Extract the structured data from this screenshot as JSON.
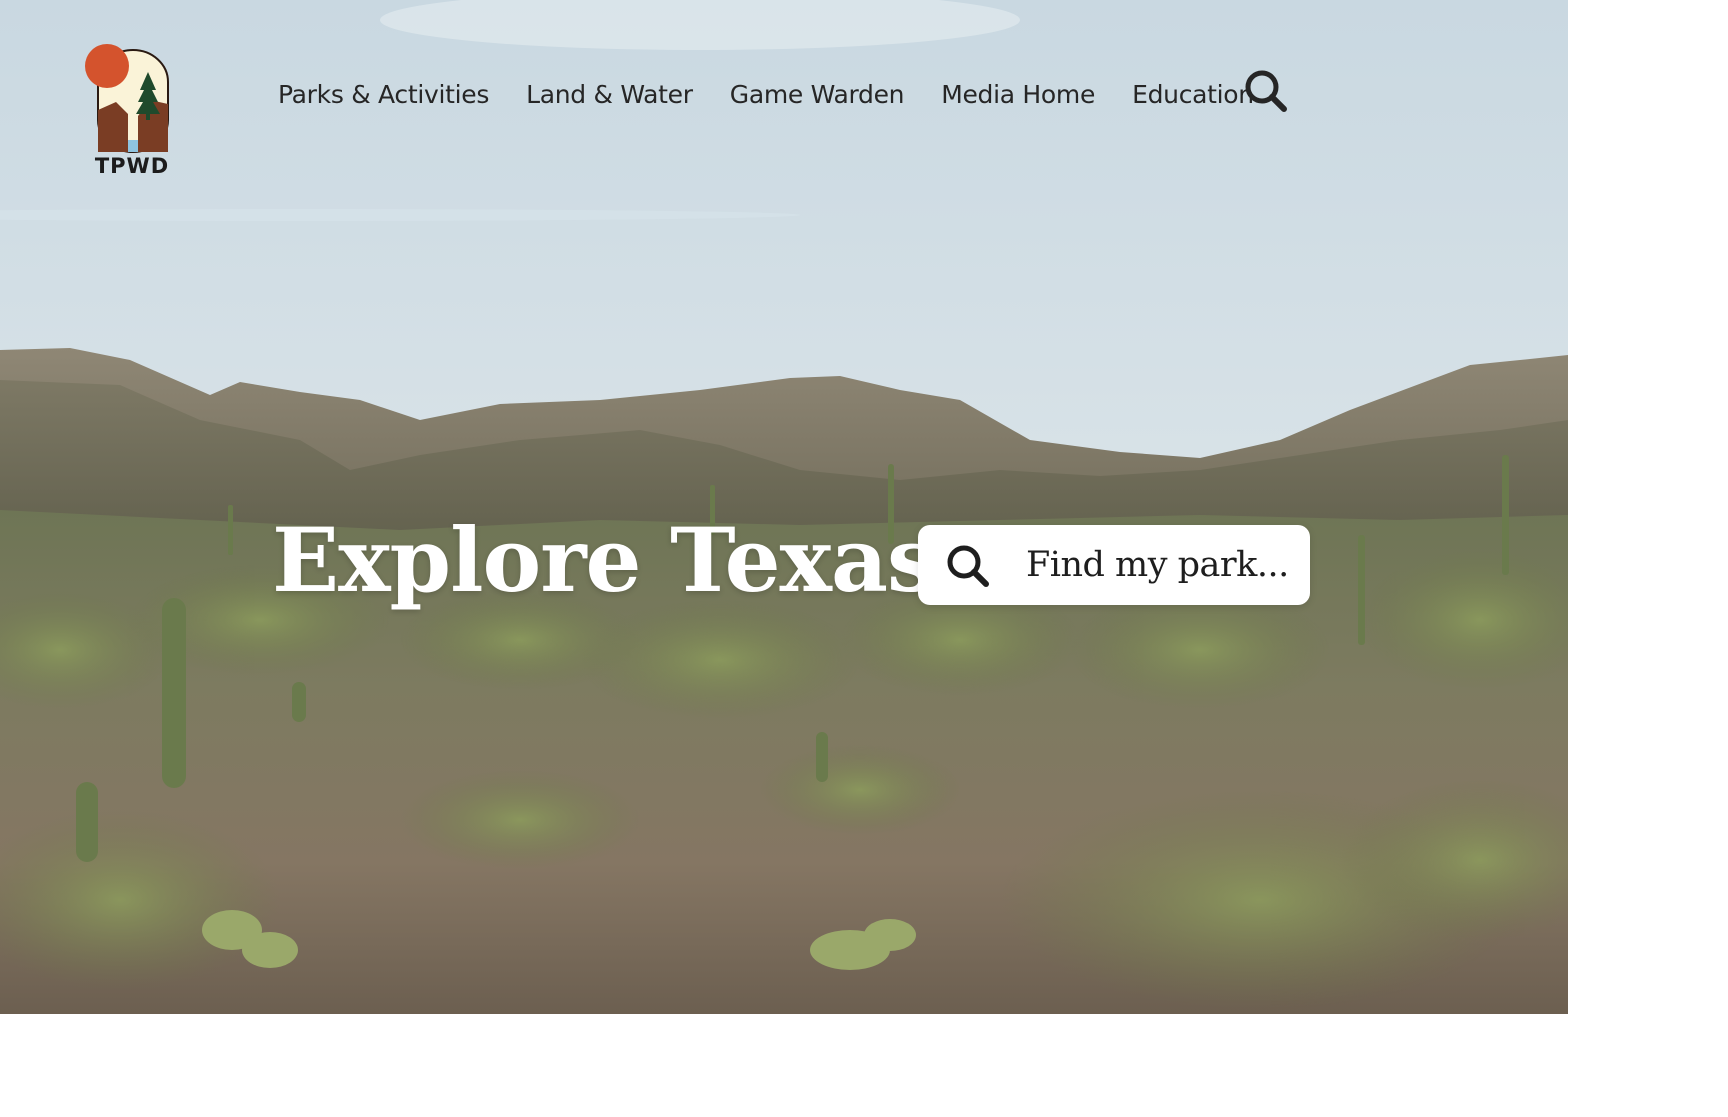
{
  "brand": {
    "logo_text": "TPWD",
    "logo_colors": {
      "sun": "#d4532d",
      "tree": "#1f4a2c",
      "earth": "#7a3d24",
      "sky": "#faf3d8"
    }
  },
  "nav": {
    "items": [
      {
        "label": "Parks & Activities"
      },
      {
        "label": "Land & Water"
      },
      {
        "label": "Game Warden"
      },
      {
        "label": "Media Home"
      },
      {
        "label": "Education"
      }
    ],
    "search_icon": "search-icon"
  },
  "hero": {
    "title": "Explore Texas",
    "search": {
      "placeholder": "Find my park...",
      "icon": "search-icon"
    },
    "background": "desert landscape with mountains and saguaro cacti"
  }
}
